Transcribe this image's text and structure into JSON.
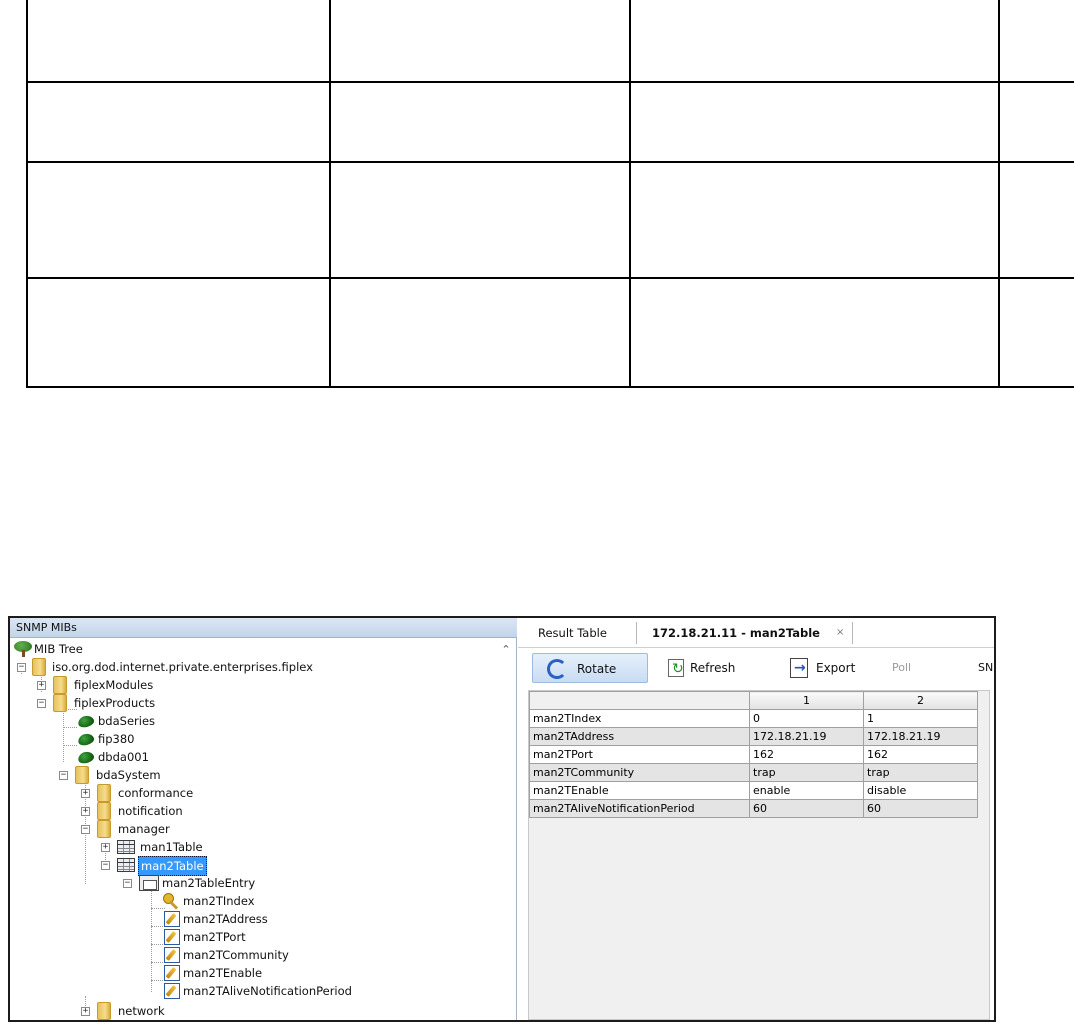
{
  "left_panel": {
    "title": "SNMP MIBs",
    "tree": [
      {
        "label": "MIB Tree"
      },
      {
        "label": "iso.org.dod.internet.private.enterprises.fiplex"
      },
      {
        "label": "fiplexModules"
      },
      {
        "label": "fiplexProducts"
      },
      {
        "label": "bdaSeries"
      },
      {
        "label": "fip380"
      },
      {
        "label": "dbda001"
      },
      {
        "label": "bdaSystem"
      },
      {
        "label": "conformance"
      },
      {
        "label": "notification"
      },
      {
        "label": "manager"
      },
      {
        "label": "man1Table"
      },
      {
        "label": "man2Table"
      },
      {
        "label": "man2TableEntry"
      },
      {
        "label": "man2TIndex"
      },
      {
        "label": "man2TAddress"
      },
      {
        "label": "man2TPort"
      },
      {
        "label": "man2TCommunity"
      },
      {
        "label": "man2TEnable"
      },
      {
        "label": "man2TAliveNotificationPeriod"
      },
      {
        "label": "network"
      }
    ]
  },
  "tabs": [
    {
      "label": "Result Table"
    },
    {
      "label": "172.18.21.11 - man2Table",
      "close": "×"
    }
  ],
  "toolbar": {
    "rotate": "Rotate",
    "refresh": "Refresh",
    "export": "Export",
    "poll": "Poll",
    "snmp": "SNI"
  },
  "result_table": {
    "columns": [
      "1",
      "2"
    ],
    "rows": [
      {
        "name": "man2TIndex",
        "values": [
          "0",
          "1"
        ]
      },
      {
        "name": "man2TAddress",
        "values": [
          "172.18.21.19",
          "172.18.21.19"
        ]
      },
      {
        "name": "man2TPort",
        "values": [
          "162",
          "162"
        ]
      },
      {
        "name": "man2TCommunity",
        "values": [
          "trap",
          "trap"
        ]
      },
      {
        "name": "man2TEnable",
        "values": [
          "enable",
          "disable"
        ]
      },
      {
        "name": "man2TAliveNotificationPeriod",
        "values": [
          "60",
          "60"
        ]
      }
    ]
  }
}
